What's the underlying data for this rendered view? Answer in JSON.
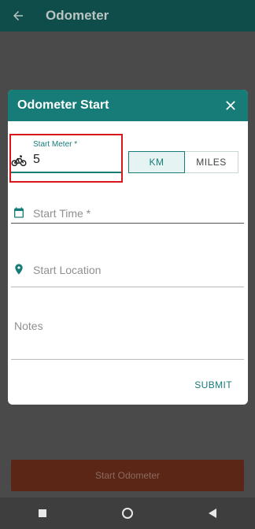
{
  "appbar": {
    "title": "Odometer"
  },
  "dialog": {
    "title": "Odometer Start",
    "start_meter": {
      "label": "Start Meter *",
      "value": "5"
    },
    "units": {
      "km": "KM",
      "miles": "MILES",
      "selected": "KM"
    },
    "start_time": {
      "placeholder": "Start Time *"
    },
    "start_location": {
      "placeholder": "Start Location"
    },
    "notes": {
      "placeholder": "Notes"
    },
    "submit_label": "SUBMIT"
  },
  "bottom_button": {
    "label": "Start Odometer"
  },
  "colors": {
    "teal": "#177c78",
    "appbar": "#0f4d4a",
    "highlight": "#d9161c"
  },
  "icons": {
    "back": "arrow-left-icon",
    "close": "close-icon",
    "meter": "bicycle-icon",
    "time": "calendar-icon",
    "location": "map-pin-icon",
    "nav": [
      "square-icon",
      "circle-icon",
      "triangle-left-icon"
    ]
  }
}
